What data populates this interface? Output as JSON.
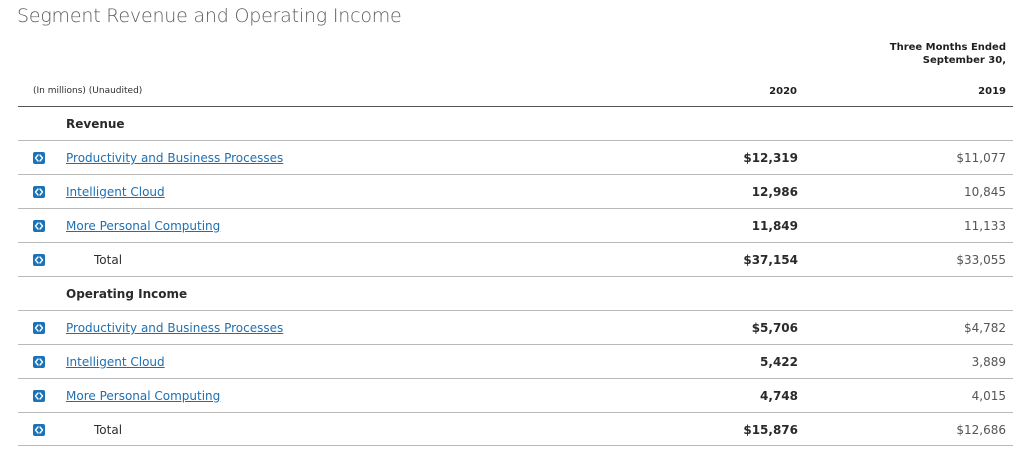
{
  "title": "Segment Revenue and Operating Income",
  "period_header": {
    "line1": "Three Months Ended",
    "line2": "September 30,"
  },
  "units_label": "(In millions) (Unaudited)",
  "columns": [
    "2020",
    "2019"
  ],
  "icon_color": "#1a73b8",
  "link_color": "#1d6fb3",
  "sections": [
    {
      "label": "Revenue",
      "rows": [
        {
          "label": "Productivity and Business Processes",
          "v2020": "$12,319",
          "v2019": "$11,077"
        },
        {
          "label": "Intelligent Cloud",
          "v2020": "12,986",
          "v2019": "10,845"
        },
        {
          "label": "More Personal Computing",
          "v2020": "11,849",
          "v2019": "11,133"
        }
      ],
      "total": {
        "label": "Total",
        "v2020": "$37,154",
        "v2019": "$33,055"
      }
    },
    {
      "label": "Operating Income",
      "rows": [
        {
          "label": "Productivity and Business Processes",
          "v2020": "$5,706",
          "v2019": "$4,782"
        },
        {
          "label": "Intelligent Cloud",
          "v2020": "5,422",
          "v2019": "3,889"
        },
        {
          "label": "More Personal Computing",
          "v2020": "4,748",
          "v2019": "4,015"
        }
      ],
      "total": {
        "label": "Total",
        "v2020": "$15,876",
        "v2019": "$12,686"
      }
    }
  ]
}
